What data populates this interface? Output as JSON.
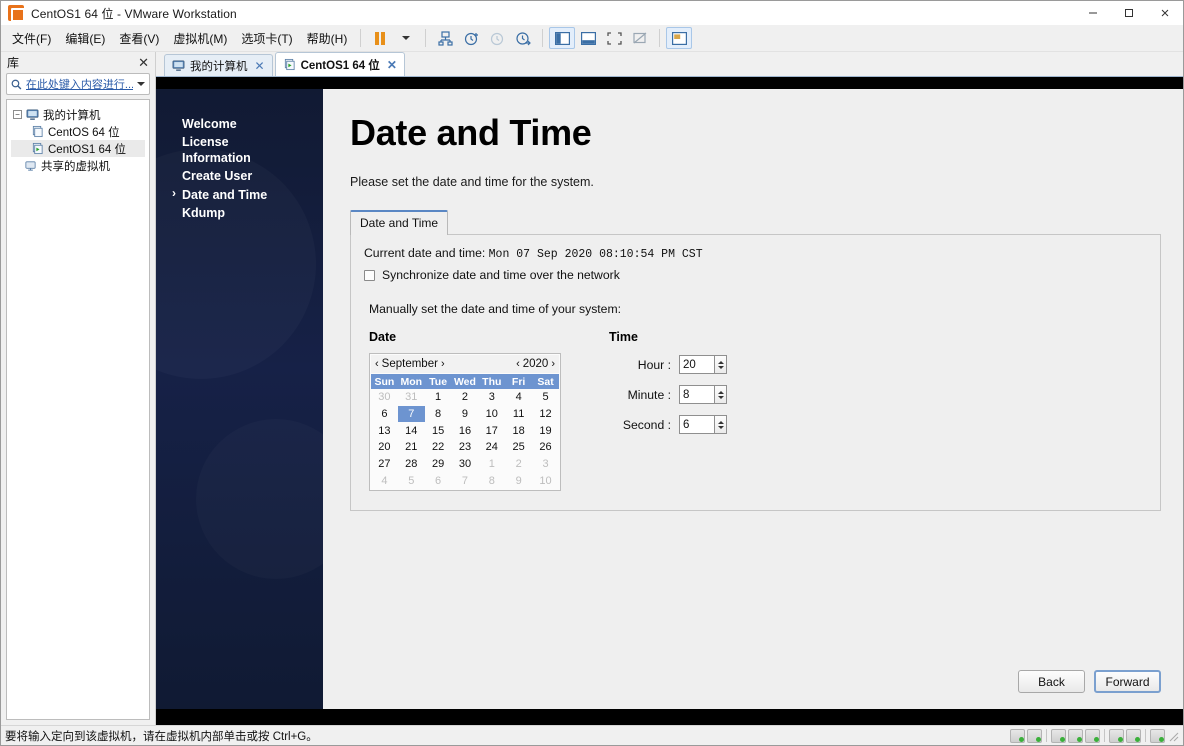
{
  "window": {
    "title": "CentOS1 64 位 - VMware Workstation",
    "app_icon": "vmware-icon",
    "controls": {
      "minimize": "minimize-icon",
      "maximize": "maximize-icon",
      "close": "close-icon"
    }
  },
  "menubar": {
    "items": [
      {
        "label": "文件(F)",
        "name": "menu-file"
      },
      {
        "label": "编辑(E)",
        "name": "menu-edit"
      },
      {
        "label": "查看(V)",
        "name": "menu-view"
      },
      {
        "label": "虚拟机(M)",
        "name": "menu-vm"
      },
      {
        "label": "选项卡(T)",
        "name": "menu-tabs"
      },
      {
        "label": "帮助(H)",
        "name": "menu-help"
      }
    ]
  },
  "toolbar": {
    "buttons": [
      {
        "name": "suspend-button",
        "icon": "pause-icon"
      },
      {
        "name": "power-dropdown",
        "icon": "chevron-down-icon"
      },
      {
        "name": "snapshot-manager-button",
        "icon": "snapshot-icon"
      },
      {
        "name": "take-snapshot-button",
        "icon": "clock-plus-icon"
      },
      {
        "name": "revert-snapshot-button",
        "icon": "clock-revert-icon"
      },
      {
        "name": "manage-snapshots-button",
        "icon": "clock-manage-icon"
      },
      {
        "name": "show-library-button",
        "icon": "library-panel-icon"
      },
      {
        "name": "show-thumbnail-bar-button",
        "icon": "thumbnail-bar-icon"
      },
      {
        "name": "fullscreen-button",
        "icon": "fullscreen-icon"
      },
      {
        "name": "unity-mode-button",
        "icon": "unity-icon"
      },
      {
        "name": "console-view-button",
        "icon": "console-view-icon"
      }
    ]
  },
  "library": {
    "title": "库",
    "close_label": "✕",
    "search_placeholder": "在此处键入内容进行...",
    "search_icon": "search-icon",
    "dropdown_icon": "chevron-down-icon",
    "tree": [
      {
        "label": "我的计算机",
        "icon": "computer-icon",
        "level": 0,
        "expander": "−",
        "selected": false
      },
      {
        "label": "CentOS 64 位",
        "icon": "vm-icon",
        "level": 1,
        "selected": false
      },
      {
        "label": "CentOS1 64 位",
        "icon": "vm-running-icon",
        "level": 1,
        "selected": true
      },
      {
        "label": "共享的虚拟机",
        "icon": "shared-vm-icon",
        "level": 0,
        "selected": false
      }
    ]
  },
  "tabs": [
    {
      "label": "我的计算机",
      "icon": "computer-icon",
      "active": false,
      "close": "✕"
    },
    {
      "label": "CentOS1 64 位",
      "icon": "vm-running-icon",
      "active": true,
      "close": "✕"
    }
  ],
  "installer": {
    "nav": [
      {
        "label": "Welcome",
        "current": false
      },
      {
        "label": "License\nInformation",
        "current": false
      },
      {
        "label": "Create User",
        "current": false
      },
      {
        "label": "Date and Time",
        "current": true
      },
      {
        "label": "Kdump",
        "current": false
      }
    ],
    "heading": "Date and Time",
    "subtitle": "Please set the date and time for the system.",
    "tab_label": "Date and Time",
    "current_datetime_label": "Current date and time:",
    "current_datetime_value": "Mon 07 Sep 2020 08:10:54 PM CST",
    "sync_checkbox_label": "Synchronize date and time over the network",
    "sync_checked": false,
    "manual_label": "Manually set the date and time of your system:",
    "date_section_title": "Date",
    "time_section_title": "Time",
    "calendar": {
      "month": "September",
      "year": "2020",
      "prev_month_icon": "chevron-left-icon",
      "next_month_icon": "chevron-right-icon",
      "prev_year_icon": "chevron-left-icon",
      "next_year_icon": "chevron-right-icon",
      "weekdays": [
        "Sun",
        "Mon",
        "Tue",
        "Wed",
        "Thu",
        "Fri",
        "Sat"
      ],
      "selected_day": 7,
      "weeks": [
        [
          {
            "d": "30",
            "o": true
          },
          {
            "d": "31",
            "o": true
          },
          {
            "d": "1"
          },
          {
            "d": "2"
          },
          {
            "d": "3"
          },
          {
            "d": "4"
          },
          {
            "d": "5"
          }
        ],
        [
          {
            "d": "6"
          },
          {
            "d": "7",
            "sel": true
          },
          {
            "d": "8"
          },
          {
            "d": "9"
          },
          {
            "d": "10"
          },
          {
            "d": "11"
          },
          {
            "d": "12"
          }
        ],
        [
          {
            "d": "13"
          },
          {
            "d": "14"
          },
          {
            "d": "15"
          },
          {
            "d": "16"
          },
          {
            "d": "17"
          },
          {
            "d": "18"
          },
          {
            "d": "19"
          }
        ],
        [
          {
            "d": "20"
          },
          {
            "d": "21"
          },
          {
            "d": "22"
          },
          {
            "d": "23"
          },
          {
            "d": "24"
          },
          {
            "d": "25"
          },
          {
            "d": "26"
          }
        ],
        [
          {
            "d": "27"
          },
          {
            "d": "28"
          },
          {
            "d": "29"
          },
          {
            "d": "30"
          },
          {
            "d": "1",
            "o": true
          },
          {
            "d": "2",
            "o": true
          },
          {
            "d": "3",
            "o": true
          }
        ],
        [
          {
            "d": "4",
            "o": true
          },
          {
            "d": "5",
            "o": true
          },
          {
            "d": "6",
            "o": true
          },
          {
            "d": "7",
            "o": true
          },
          {
            "d": "8",
            "o": true
          },
          {
            "d": "9",
            "o": true
          },
          {
            "d": "10",
            "o": true
          }
        ]
      ]
    },
    "time_fields": [
      {
        "label": "Hour :",
        "value": "20",
        "name": "hour-spinner"
      },
      {
        "label": "Minute :",
        "value": "8",
        "name": "minute-spinner"
      },
      {
        "label": "Second :",
        "value": "6",
        "name": "second-spinner"
      }
    ],
    "back_label": "Back",
    "forward_label": "Forward"
  },
  "statusbar": {
    "message": "要将输入定向到该虚拟机，请在虚拟机内部单击或按 Ctrl+G。",
    "tray_icons": [
      "harddisk-icon",
      "cdrom-icon",
      "network-icon",
      "printer-icon",
      "usb-icon",
      "sound-icon",
      "display-icon",
      "folder-icon"
    ]
  },
  "colors": {
    "accent": "#6d94d0",
    "installer_sidebar": "#162147",
    "installer_bg": "#efefef",
    "tab_accent": "#5a87c4"
  }
}
